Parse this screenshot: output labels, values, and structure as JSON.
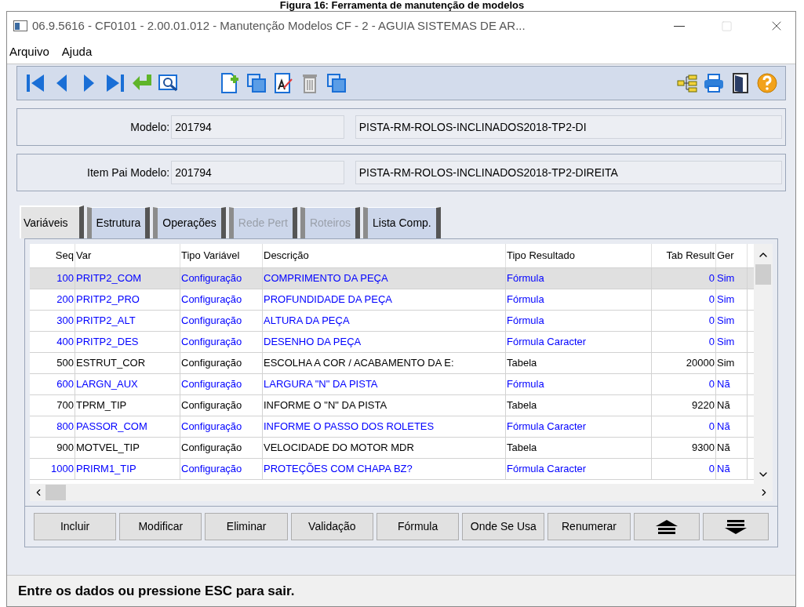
{
  "caption": "Figura 16: Ferramenta de manutenção de modelos",
  "window": {
    "title": "06.9.5616 - CF0101 - 2.00.01.012 - Manutenção Modelos CF - 2 - AGUIA SISTEMAS DE AR..."
  },
  "menu": [
    "Arquivo",
    "Ajuda"
  ],
  "fields": [
    {
      "label": "Modelo:",
      "value": "201794",
      "description": "PISTA-RM-ROLOS-INCLINADOS2018-TP2-DI"
    },
    {
      "label": "Item Pai Modelo:",
      "value": "201794",
      "description": "PISTA-RM-ROLOS-INCLINADOS2018-TP2-DIREITA"
    }
  ],
  "tabs": [
    {
      "label": "Variáveis",
      "selected": true,
      "disabled": false
    },
    {
      "label": "Estrutura",
      "selected": false,
      "disabled": false
    },
    {
      "label": "Operações",
      "selected": false,
      "disabled": false
    },
    {
      "label": "Rede Pert",
      "selected": false,
      "disabled": true
    },
    {
      "label": "Roteiros",
      "selected": false,
      "disabled": true
    },
    {
      "label": "Lista Comp.",
      "selected": false,
      "disabled": false
    }
  ],
  "table": {
    "columns": [
      "Seq",
      "Var",
      "Tipo Variável",
      "Descrição",
      "Tipo Resultado",
      "Tab Result",
      "Ger"
    ],
    "rows": [
      {
        "selected": true,
        "color": "#0000ff",
        "cells": [
          "100",
          "PRITP2_COM",
          "Configuração",
          "COMPRIMENTO DA PEÇA",
          "Fórmula",
          "0",
          "Sim"
        ]
      },
      {
        "selected": false,
        "color": "#0000ff",
        "cells": [
          "200",
          "PRITP2_PRO",
          "Configuração",
          "PROFUNDIDADE DA PEÇA",
          "Fórmula",
          "0",
          "Sim"
        ]
      },
      {
        "selected": false,
        "color": "#0000ff",
        "cells": [
          "300",
          "PRITP2_ALT",
          "Configuração",
          "ALTURA DA PEÇA",
          "Fórmula",
          "0",
          "Sim"
        ]
      },
      {
        "selected": false,
        "color": "#0000ff",
        "cells": [
          "400",
          "PRITP2_DES",
          "Configuração",
          "DESENHO DA PEÇA",
          "Fórmula Caracter",
          "0",
          "Sim"
        ]
      },
      {
        "selected": false,
        "color": "#000000",
        "cells": [
          "500",
          "ESTRUT_COR",
          "Configuração",
          "ESCOLHA A COR / ACABAMENTO DA E:",
          "Tabela",
          "20000",
          "Sim"
        ]
      },
      {
        "selected": false,
        "color": "#0000ff",
        "cells": [
          "600",
          "LARGN_AUX",
          "Configuração",
          "LARGURA \"N\" DA PISTA",
          "Fórmula",
          "0",
          "Nã"
        ]
      },
      {
        "selected": false,
        "color": "#000000",
        "cells": [
          "700",
          "TPRM_TIP",
          "Configuração",
          "INFORME O \"N\" DA PISTA",
          "Tabela",
          "9220",
          "Nã"
        ]
      },
      {
        "selected": false,
        "color": "#0000ff",
        "cells": [
          "800",
          "PASSOR_COM",
          "Configuração",
          "INFORME O PASSO DOS ROLETES",
          "Fórmula Caracter",
          "0",
          "Nã"
        ]
      },
      {
        "selected": false,
        "color": "#000000",
        "cells": [
          "900",
          "MOTVEL_TIP",
          "Configuração",
          "VELOCIDADE DO MOTOR MDR",
          "Tabela",
          "9300",
          "Nã"
        ]
      },
      {
        "selected": false,
        "color": "#0000ff",
        "cells": [
          "1000",
          "PRIRM1_TIP",
          "Configuração",
          "PROTEÇÕES COM CHAPA BZ?",
          "Fórmula Caracter",
          "0",
          "Nã"
        ]
      }
    ]
  },
  "buttons": [
    {
      "kind": "text",
      "label": "Incluir"
    },
    {
      "kind": "text",
      "label": "Modificar"
    },
    {
      "kind": "text",
      "label": "Eliminar"
    },
    {
      "kind": "text",
      "label": "Validação"
    },
    {
      "kind": "text",
      "label": "Fórmula"
    },
    {
      "kind": "text",
      "label": "Onde Se Usa"
    },
    {
      "kind": "text",
      "label": "Renumerar"
    },
    {
      "kind": "up"
    },
    {
      "kind": "down"
    }
  ],
  "status_bar": "Entre os dados ou pressione ESC para sair."
}
